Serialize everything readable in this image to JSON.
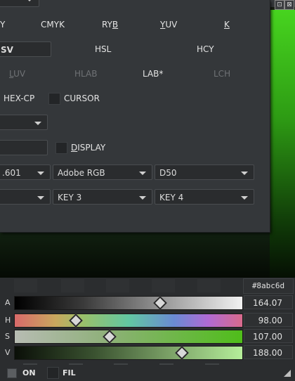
{
  "title_buttons": {
    "float": "⊡",
    "close": "⊠"
  },
  "models": {
    "row1": [
      "Y",
      "CMYK",
      "RYB",
      "YUV",
      "K"
    ],
    "row2_active": "SV",
    "row2": [
      "HSL",
      "HCY"
    ],
    "row3": [
      "LUV",
      "HLAB",
      "LAB*",
      "LCH"
    ]
  },
  "options": {
    "hex_cp": "HEX-CP",
    "cursor": "CURSOR",
    "display": "DISPLAY"
  },
  "selects": {
    "gamma": ".601",
    "profile": "Adobe RGB",
    "illuminant": "D50",
    "key3": "KEY 3",
    "key4": "KEY 4"
  },
  "hex_value": "#8abc6d",
  "channels": [
    {
      "label": "A",
      "value": "164.07",
      "level": 0.643
    },
    {
      "label": "H",
      "value": "98.00",
      "level": 0.272
    },
    {
      "label": "S",
      "value": "107.00",
      "level": 0.42
    },
    {
      "label": "V",
      "value": "188.00",
      "level": 0.737
    }
  ],
  "footer": {
    "on": "ON",
    "fil": "FIL"
  }
}
